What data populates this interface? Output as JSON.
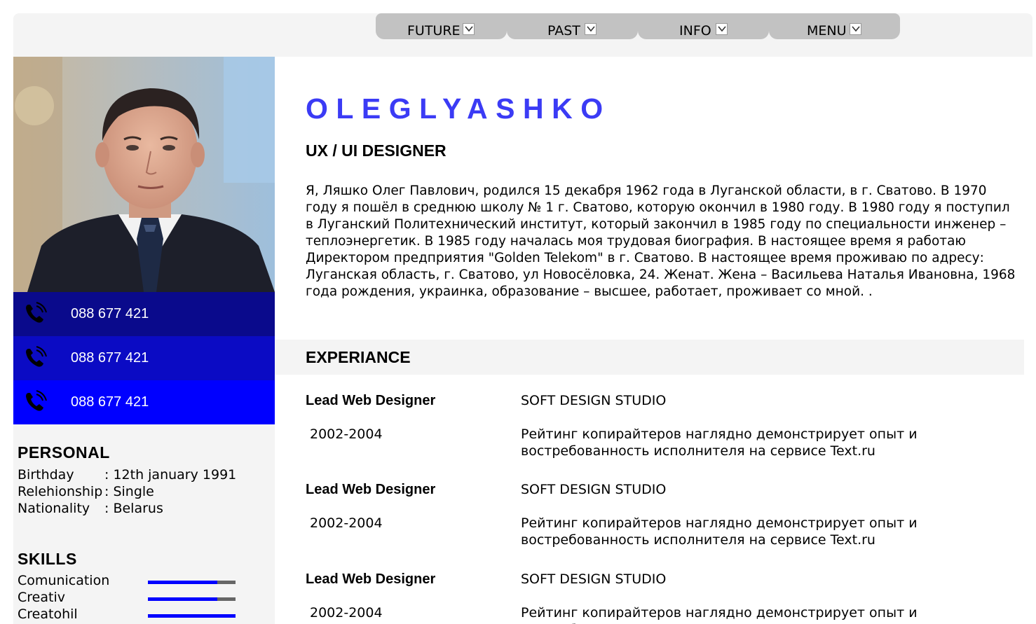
{
  "nav": {
    "items": [
      {
        "label": "FUTURE"
      },
      {
        "label": "PAST"
      },
      {
        "label": "INFO"
      },
      {
        "label": "MENU"
      }
    ]
  },
  "sidebar": {
    "phones": [
      "088 677 421",
      "088 677 421",
      "088 677 421"
    ],
    "personal": {
      "title": "PERSONAL",
      "rows": [
        {
          "key": "Birthday",
          "value": ": 12th january 1991"
        },
        {
          "key": "Relehionship",
          "value": ": Single"
        },
        {
          "key": "Nationality",
          "value": ": Belarus"
        }
      ]
    },
    "skills": {
      "title": "SKILLS",
      "items": [
        {
          "name": "Comunication",
          "level": 0.79
        },
        {
          "name": "Creativ",
          "level": 0.79
        },
        {
          "name": "Creatohil",
          "level": 1.0
        }
      ]
    }
  },
  "main": {
    "name": "OLEGLYASHKO",
    "role": "UX / UI DESIGNER",
    "bio": "Я, Ляшко Олег Павлович, родился 15 декабря 1962 года в Луганской области, в г. Сватово. В 1970 году я пошёл в среднюю школу № 1 г. Сватово, которую окончил в 1980 году. В 1980 году я поступил в Луганский Политехнический институт, который закончил в 1985 году по специальности инженер – теплоэнергетик. В 1985 году началась моя трудовая биография. В настоящее время я работаю Директором предприятия \"Golden Telekom\" в г. Сватово. В настоящее время проживаю по адресу: Луганская область, г. Сватово, ул Новосёловка, 24. Женат. Жена – Васильева Наталья Ивановна, 1968 года рождения, украинка, образование – высшее, работает, проживает со мной. .",
    "experience": {
      "title": "EXPERIANCE",
      "jobs": [
        {
          "title": "Lead Web Designer",
          "company": "SOFT DESIGN STUDIO",
          "years": "2002-2004",
          "desc": "Рейтинг копирайтеров наглядно демонстрирует опыт и востребованность исполнителя на сервисе Text.ru"
        },
        {
          "title": "Lead Web Designer",
          "company": "SOFT DESIGN STUDIO",
          "years": "2002-2004",
          "desc": "Рейтинг копирайтеров наглядно демонстрирует опыт и востребованность исполнителя на сервисе Text.ru"
        },
        {
          "title": "Lead Web Designer",
          "company": "SOFT DESIGN STUDIO",
          "years": "2002-2004",
          "desc": "Рейтинг копирайтеров наглядно демонстрирует опыт и востребованность исполнителя на сервисе Text.ru"
        }
      ]
    }
  },
  "colors": {
    "accent": "#3b3bf5",
    "phone_row_1": "#0a0a8c",
    "phone_row_2": "#0b0bc4",
    "phone_row_3": "#0000ff",
    "panel_bg": "#f4f4f4",
    "nav_tab_bg": "#c2c2c2"
  },
  "icons": {
    "nav_dropdown": "chevron-down-icon",
    "phone": "phone-ringing-icon"
  }
}
